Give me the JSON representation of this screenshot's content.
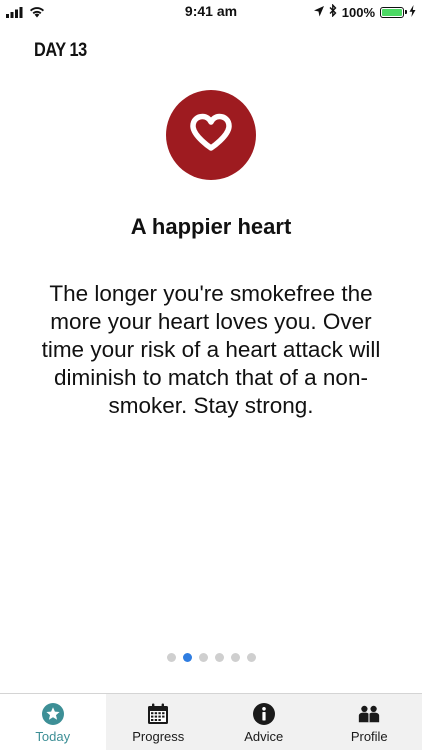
{
  "status_bar": {
    "time": "9:41 am",
    "battery_percent": "100%",
    "battery_level": 1.0,
    "icons": [
      "signal-icon",
      "wifi-icon",
      "location-arrow-icon",
      "bluetooth-icon",
      "battery-icon",
      "charging-icon"
    ]
  },
  "day_label": "DAY 13",
  "card": {
    "icon": "heart-icon",
    "icon_bg_color": "#9e1b20",
    "title": "A happier heart",
    "body": "The longer you're smokefree the more your heart loves you. Over time your risk of a heart attack will diminish to match that of a non-smoker. Stay strong."
  },
  "pagination": {
    "total": 6,
    "current_index": 1,
    "active_color": "#2f7de1"
  },
  "tabs": [
    {
      "label": "Today",
      "icon": "star-badge-icon",
      "active": true
    },
    {
      "label": "Progress",
      "icon": "calendar-icon",
      "active": false
    },
    {
      "label": "Advice",
      "icon": "info-icon",
      "active": false
    },
    {
      "label": "Profile",
      "icon": "people-icon",
      "active": false
    }
  ],
  "colors": {
    "accent_teal": "#3d8f96"
  }
}
